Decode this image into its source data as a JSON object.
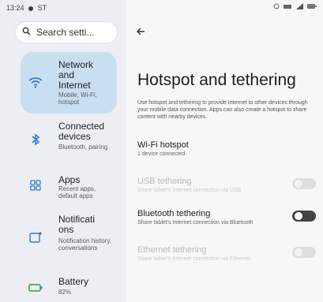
{
  "status_bar": {
    "time": "13:24",
    "carrier": "ST",
    "icons": [
      "alarm-icon",
      "vibrate-icon",
      "signal-icon",
      "battery-icon"
    ]
  },
  "search": {
    "placeholder": "Search setti..."
  },
  "sidebar": {
    "items": [
      {
        "label": "Network and Internet",
        "sub": "Mobile, Wi-Fi, hotspot",
        "icon": "wifi-icon",
        "active": true
      },
      {
        "label": "Connected devices",
        "sub": "Bluetooth, pairing",
        "icon": "bluetooth-icon",
        "active": false
      },
      {
        "label": "Apps",
        "sub": "Recent apps, default apps",
        "icon": "apps-grid-icon",
        "active": false
      },
      {
        "label": "Notifications",
        "sub": "Notification history, conversations",
        "icon": "notification-icon",
        "active": false
      },
      {
        "label": "Battery",
        "sub": "82%",
        "icon": "battery-icon",
        "active": false
      }
    ]
  },
  "page": {
    "title": "Hotspot and tethering",
    "description": "Use hotspot and tethering to provide Internet to other devices through your mobile data connection. Apps can also create a hotspot to share content with nearby devices."
  },
  "settings": [
    {
      "title": "Wi-Fi hotspot",
      "sub": "1 device connected",
      "enabled": true,
      "toggle": null
    },
    {
      "title": "USB tethering",
      "sub": "Share tablet's Internet connection via USB",
      "enabled": false,
      "toggle": false
    },
    {
      "title": "Bluetooth tethering",
      "sub": "Share tablet's Internet connection via Bluetooth",
      "enabled": true,
      "toggle": false
    },
    {
      "title": "Ethernet tethering",
      "sub": "Share tablet's Internet connection via Ethernet",
      "enabled": false,
      "toggle": false
    }
  ],
  "colors": {
    "accent_bg": "#c8dff2",
    "accent_icon": "#2b7cd3",
    "toggle_off": "#444444"
  }
}
